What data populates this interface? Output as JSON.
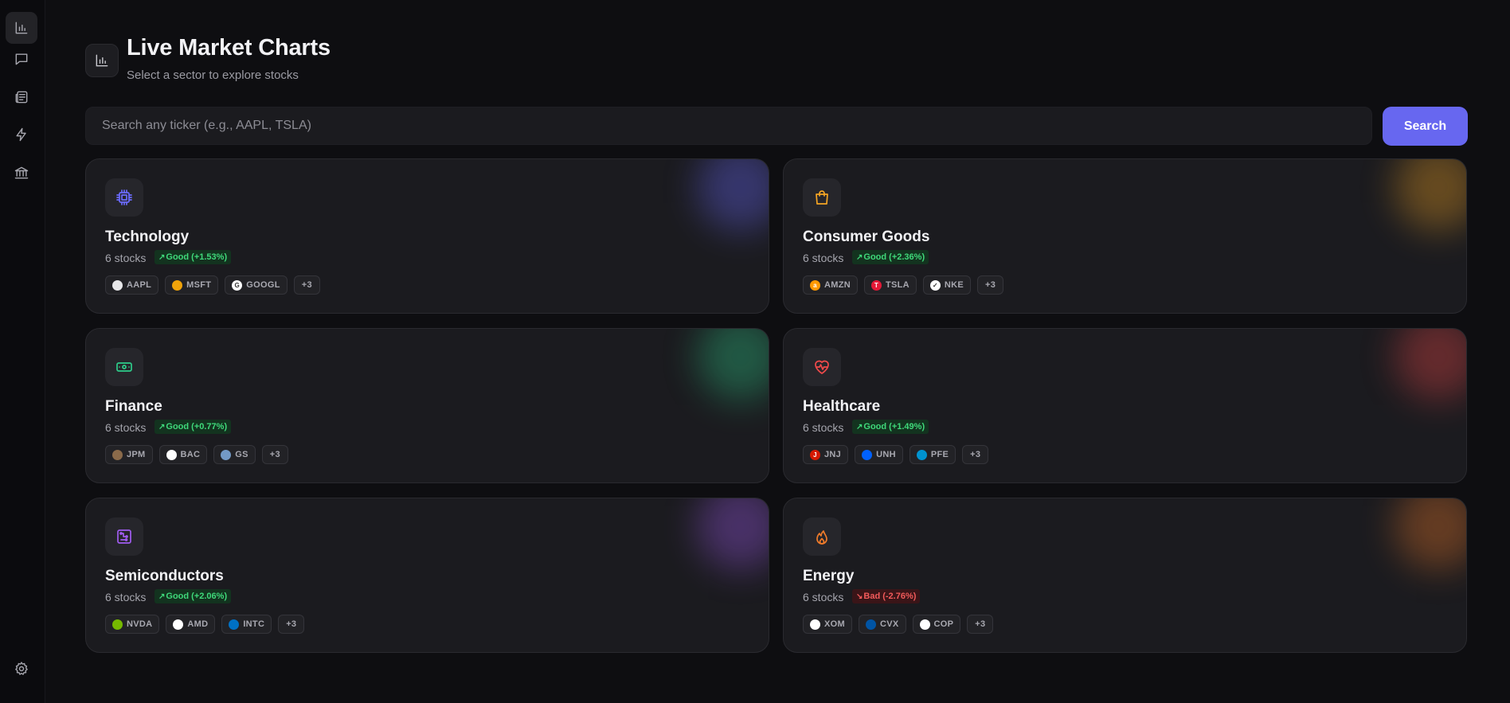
{
  "header": {
    "title": "Live Market Charts",
    "subtitle": "Select a sector to explore stocks"
  },
  "search": {
    "placeholder": "Search any ticker (e.g., AAPL, TSLA)",
    "value": "",
    "button_label": "Search"
  },
  "sidebar": {
    "items": [
      {
        "icon": "bar-chart-icon",
        "active": true
      },
      {
        "icon": "chat-icon",
        "active": false
      },
      {
        "icon": "newspaper-icon",
        "active": false
      },
      {
        "icon": "lightning-icon",
        "active": false
      },
      {
        "icon": "bank-icon",
        "active": false
      }
    ],
    "footer_icon": "gear-icon"
  },
  "colors": {
    "accent": "#6767f0",
    "good": "#3fd97a",
    "bad": "#f25a5a",
    "background": "#0e0e11",
    "card": "#1b1b1f"
  },
  "sectors": [
    {
      "name": "Technology",
      "count": "6 stocks",
      "status": "Good (+1.53%)",
      "trend": "good",
      "icon": "cpu-chip-icon",
      "color": "#6b6bff",
      "tickers": [
        {
          "symbol": "AAPL",
          "logo_color": "#e8e8ea",
          "logo_text": ""
        },
        {
          "symbol": "MSFT",
          "logo_color": "#f0a30a",
          "logo_text": ""
        },
        {
          "symbol": "GOOGL",
          "logo_color": "#ffffff",
          "logo_text": "G"
        }
      ],
      "more": "+3"
    },
    {
      "name": "Consumer Goods",
      "count": "6 stocks",
      "status": "Good (+2.36%)",
      "trend": "good",
      "icon": "shopping-bag-icon",
      "color": "#f5a524",
      "tickers": [
        {
          "symbol": "AMZN",
          "logo_color": "#ff9900",
          "logo_text": "a"
        },
        {
          "symbol": "TSLA",
          "logo_color": "#e31937",
          "logo_text": "T"
        },
        {
          "symbol": "NKE",
          "logo_color": "#ffffff",
          "logo_text": "✓"
        }
      ],
      "more": "+3"
    },
    {
      "name": "Finance",
      "count": "6 stocks",
      "status": "Good (+0.77%)",
      "trend": "good",
      "icon": "banknote-icon",
      "color": "#2ecc8a",
      "tickers": [
        {
          "symbol": "JPM",
          "logo_color": "#8a6a4a",
          "logo_text": ""
        },
        {
          "symbol": "BAC",
          "logo_color": "#ffffff",
          "logo_text": ""
        },
        {
          "symbol": "GS",
          "logo_color": "#7399c6",
          "logo_text": ""
        }
      ],
      "more": "+3"
    },
    {
      "name": "Healthcare",
      "count": "6 stocks",
      "status": "Good (+1.49%)",
      "trend": "good",
      "icon": "heart-pulse-icon",
      "color": "#f04a4a",
      "tickers": [
        {
          "symbol": "JNJ",
          "logo_color": "#d51900",
          "logo_text": "J"
        },
        {
          "symbol": "UNH",
          "logo_color": "#0061ff",
          "logo_text": ""
        },
        {
          "symbol": "PFE",
          "logo_color": "#0093d0",
          "logo_text": ""
        }
      ],
      "more": "+3"
    },
    {
      "name": "Semiconductors",
      "count": "6 stocks",
      "status": "Good (+2.06%)",
      "trend": "good",
      "icon": "circuit-icon",
      "color": "#a05cf0",
      "tickers": [
        {
          "symbol": "NVDA",
          "logo_color": "#76b900",
          "logo_text": ""
        },
        {
          "symbol": "AMD",
          "logo_color": "#ffffff",
          "logo_text": ""
        },
        {
          "symbol": "INTC",
          "logo_color": "#0071c5",
          "logo_text": ""
        }
      ],
      "more": "+3"
    },
    {
      "name": "Energy",
      "count": "6 stocks",
      "status": "Bad (-2.76%)",
      "trend": "bad",
      "icon": "flame-icon",
      "color": "#f07b2a",
      "tickers": [
        {
          "symbol": "XOM",
          "logo_color": "#ffffff",
          "logo_text": ""
        },
        {
          "symbol": "CVX",
          "logo_color": "#0054a4",
          "logo_text": ""
        },
        {
          "symbol": "COP",
          "logo_color": "#ffffff",
          "logo_text": ""
        }
      ],
      "more": "+3"
    }
  ]
}
